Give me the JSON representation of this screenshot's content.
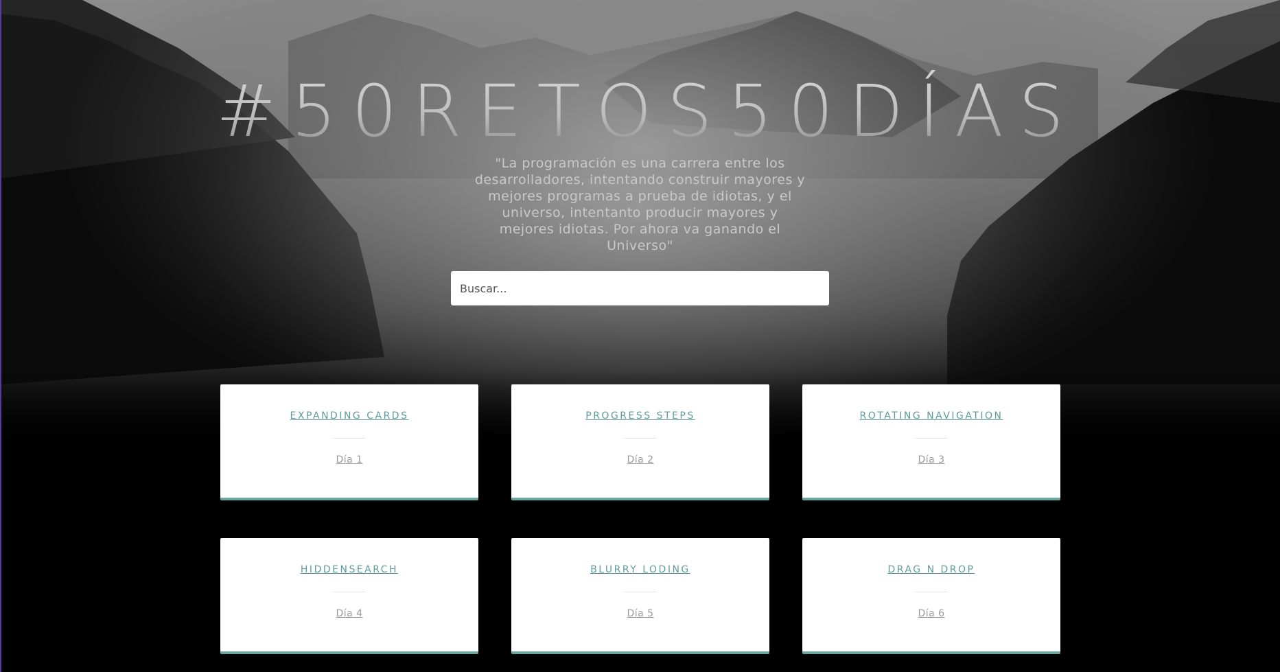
{
  "hero": {
    "title": "#50RETOS50DÍAS",
    "quote": "\"La programación es una carrera entre los desarrolladores, intentando construir mayores y mejores programas a prueba de idiotas, y el universo, intentanto producir mayores y mejores idiotas. Por ahora va ganando el Universo\""
  },
  "search": {
    "placeholder": "Buscar..."
  },
  "cards": [
    {
      "title": "EXPANDING CARDS",
      "day": "Día 1"
    },
    {
      "title": "PROGRESS STEPS",
      "day": "Día 2"
    },
    {
      "title": "ROTATING NAVIGATION",
      "day": "Día 3"
    },
    {
      "title": "HIDDENSEARCH",
      "day": "Día 4"
    },
    {
      "title": "BLURRY LODING",
      "day": "Día 5"
    },
    {
      "title": "DRAG N DROP",
      "day": "Día 6"
    }
  ],
  "colors": {
    "accent": "#6aa8a3",
    "card_title": "#5f9b9a",
    "card_day": "#9a9a9a",
    "background": "#000000"
  }
}
